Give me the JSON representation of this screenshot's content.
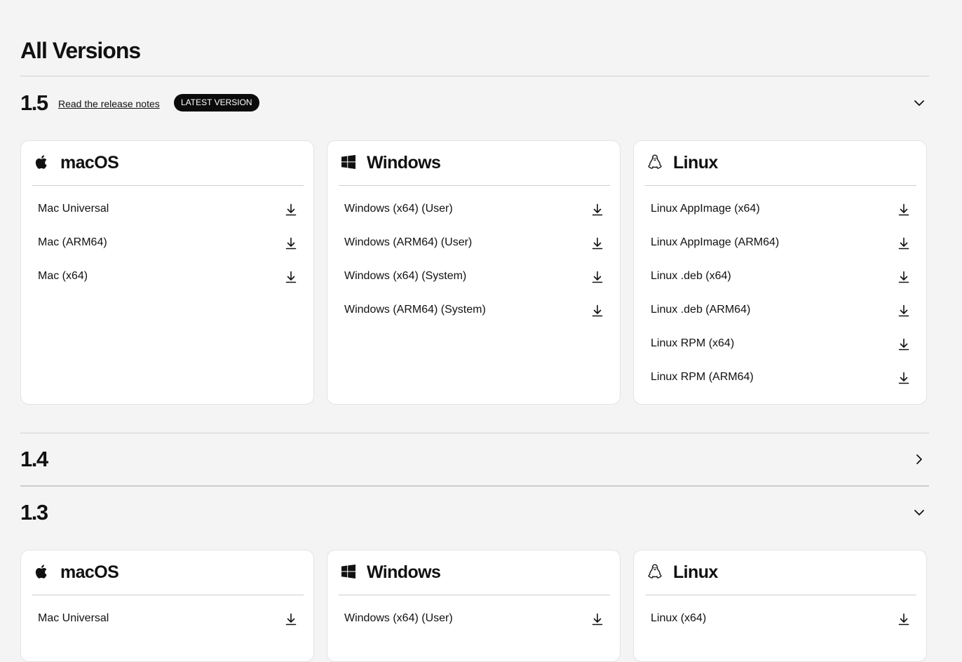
{
  "page": {
    "title": "All Versions"
  },
  "versions": [
    {
      "number": "1.5",
      "release_notes": "Read the release notes",
      "badge": "LATEST VERSION",
      "expanded": true,
      "platforms": [
        {
          "name": "macOS",
          "icon": "apple-icon",
          "items": [
            "Mac Universal",
            "Mac (ARM64)",
            "Mac (x64)"
          ]
        },
        {
          "name": "Windows",
          "icon": "windows-icon",
          "items": [
            "Windows (x64) (User)",
            "Windows (ARM64) (User)",
            "Windows (x64) (System)",
            "Windows (ARM64) (System)"
          ]
        },
        {
          "name": "Linux",
          "icon": "linux-penguin-icon",
          "items": [
            "Linux AppImage (x64)",
            "Linux AppImage (ARM64)",
            "Linux .deb (x64)",
            "Linux .deb (ARM64)",
            "Linux RPM (x64)",
            "Linux RPM (ARM64)"
          ]
        }
      ]
    },
    {
      "number": "1.4",
      "expanded": false
    },
    {
      "number": "1.3",
      "expanded": true,
      "platforms": [
        {
          "name": "macOS",
          "icon": "apple-icon",
          "items": [
            "Mac Universal"
          ]
        },
        {
          "name": "Windows",
          "icon": "windows-icon",
          "items": [
            "Windows (x64) (User)"
          ]
        },
        {
          "name": "Linux",
          "icon": "linux-penguin-icon",
          "items": [
            "Linux (x64)"
          ]
        }
      ]
    }
  ],
  "colors": {
    "background": "#f4f4f4",
    "card": "#ffffff",
    "badge": "#0b0b0b",
    "text": "#111111"
  }
}
